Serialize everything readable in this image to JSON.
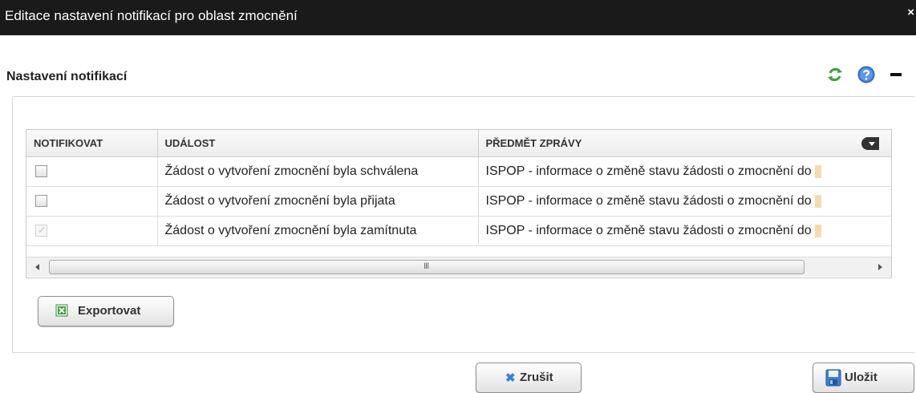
{
  "window": {
    "title": "Editace nastavení notifikací pro oblast zmocnění",
    "close_label": "×"
  },
  "section": {
    "title": "Nastavení notifikací"
  },
  "toolbar_icons": [
    "refresh-icon",
    "help-icon",
    "minimize-icon"
  ],
  "grid": {
    "columns": [
      "NOTIFIKOVAT",
      "UDÁLOST",
      "PŘEDMĚT ZPRÁVY"
    ],
    "rows": [
      {
        "notify": false,
        "disabled": false,
        "event": "Žádost o vytvoření zmocnění byla schválena",
        "subject": "ISPOP - informace o změně stavu žádosti o zmocnění do"
      },
      {
        "notify": false,
        "disabled": false,
        "event": "Žádost o vytvoření zmocnění byla přijata",
        "subject": "ISPOP - informace o změně stavu žádosti o zmocnění do"
      },
      {
        "notify": true,
        "disabled": true,
        "event": "Žádost o vytvoření zmocnění byla zamítnuta",
        "subject": "ISPOP - informace o změně stavu žádosti o zmocnění do"
      }
    ],
    "scrollbar_grip": "III"
  },
  "buttons": {
    "export": "Exportovat",
    "cancel": "Zrušit",
    "save": "Uložit"
  },
  "colors": {
    "titlebar": "#1a1a1a",
    "refresh": "#3aa13a",
    "help": "#3a78d8",
    "cancel_icon": "#3d7edb"
  }
}
